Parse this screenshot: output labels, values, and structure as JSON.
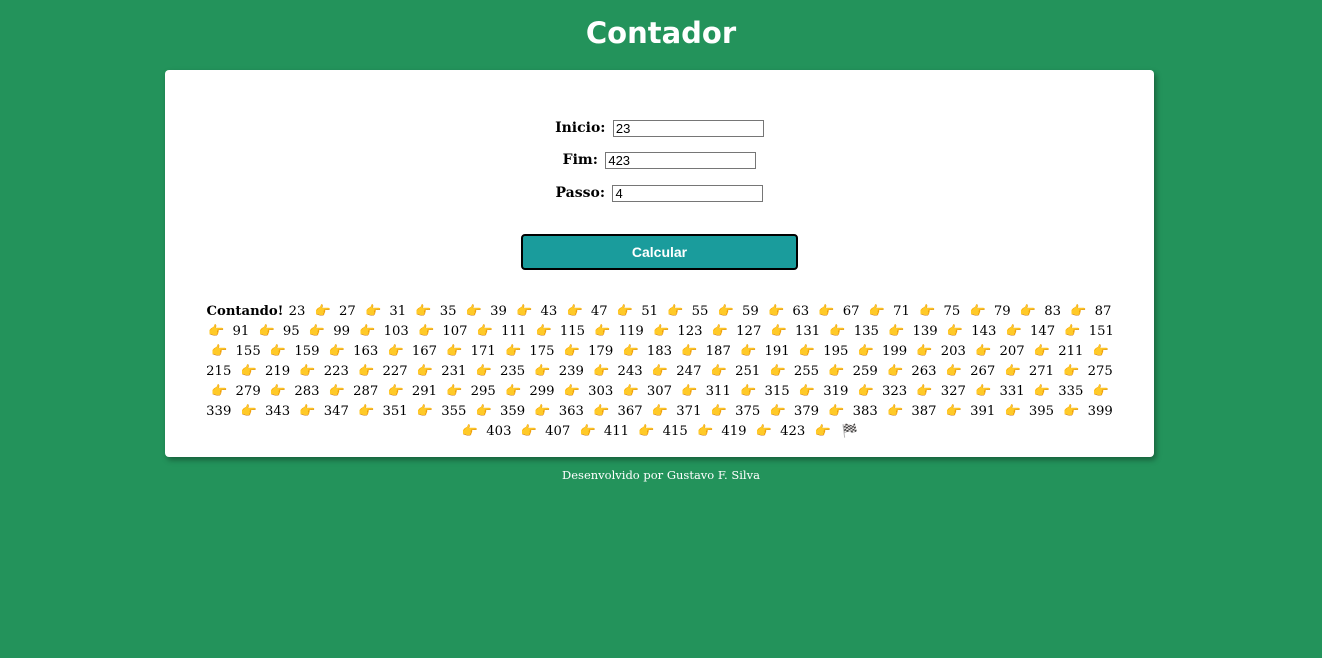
{
  "header": {
    "title": "Contador"
  },
  "form": {
    "inicio_label": "Inicio:",
    "inicio_value": "23",
    "fim_label": "Fim:",
    "fim_value": "423",
    "passo_label": "Passo:",
    "passo_value": "4",
    "button_label": "Calcular"
  },
  "result": {
    "lead": "Contando!",
    "values": [
      "23",
      "27",
      "31",
      "35",
      "39",
      "43",
      "47",
      "51",
      "55",
      "59",
      "63",
      "67",
      "71",
      "75",
      "79",
      "83",
      "87",
      "91",
      "95",
      "99",
      "103",
      "107",
      "111",
      "115",
      "119",
      "123",
      "127",
      "131",
      "135",
      "139",
      "143",
      "147",
      "151",
      "155",
      "159",
      "163",
      "167",
      "171",
      "175",
      "179",
      "183",
      "187",
      "191",
      "195",
      "199",
      "203",
      "207",
      "211",
      "215",
      "219",
      "223",
      "227",
      "231",
      "235",
      "239",
      "243",
      "247",
      "251",
      "255",
      "259",
      "263",
      "267",
      "271",
      "275",
      "279",
      "283",
      "287",
      "291",
      "295",
      "299",
      "303",
      "307",
      "311",
      "315",
      "319",
      "323",
      "327",
      "331",
      "335",
      "339",
      "343",
      "347",
      "351",
      "355",
      "359",
      "363",
      "367",
      "371",
      "375",
      "379",
      "383",
      "387",
      "391",
      "395",
      "399",
      "403",
      "407",
      "411",
      "415",
      "419",
      "423"
    ],
    "separator_icon": "pointing-hand-icon",
    "separator_glyph": "👉",
    "end_icon": "checkered-flag-icon",
    "end_glyph": "🏁"
  },
  "footer": {
    "text": "Desenvolvido por Gustavo F. Silva"
  },
  "colors": {
    "background": "#23935b",
    "button": "#1a9c9c",
    "card": "#ffffff"
  }
}
